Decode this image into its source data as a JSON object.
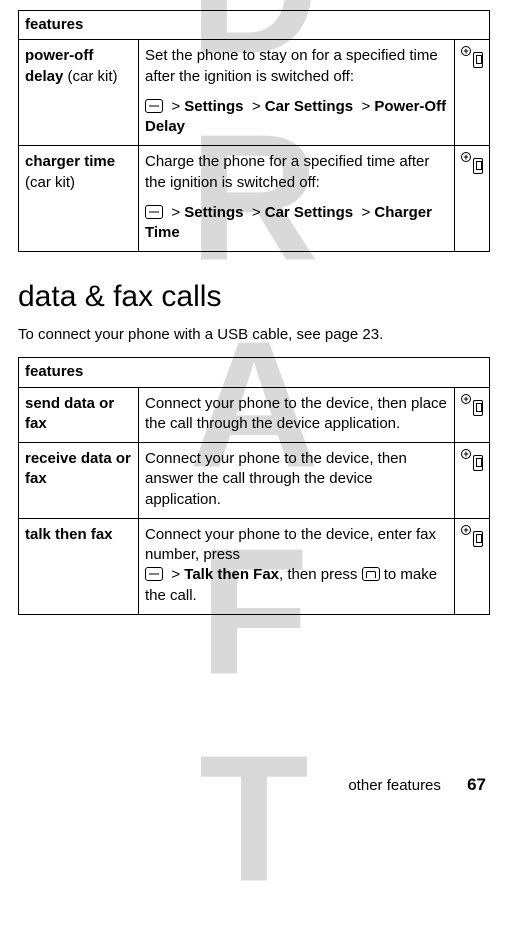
{
  "watermark": "DRAFT",
  "table1": {
    "header": "features",
    "rows": [
      {
        "name_bold": "power-off delay",
        "name_rest": " (car kit)",
        "desc": "Set the phone to stay on for a specified time after the ignition is switched off:",
        "path": [
          "Settings",
          "Car Settings",
          "Power-Off Delay"
        ],
        "icon": "accessory-required-icon"
      },
      {
        "name_bold": "charger time",
        "name_rest": " (car kit)",
        "desc": "Charge the phone for a specified time after the ignition is switched off:",
        "path": [
          "Settings",
          "Car Settings",
          "Charger Time"
        ],
        "icon": "accessory-required-icon"
      }
    ]
  },
  "section_title": "data & fax calls",
  "section_intro": "To connect your phone with a USB cable, see page 23.",
  "table2": {
    "header": "features",
    "rows": [
      {
        "name_bold": "send data or fax",
        "name_rest": "",
        "desc": "Connect your phone to the device, then place the call through the device application.",
        "icon": "accessory-required-icon"
      },
      {
        "name_bold": "receive data or fax",
        "name_rest": "",
        "desc": "Connect your phone to the device, then answer the call through the device application.",
        "icon": "accessory-required-icon"
      },
      {
        "name_bold": "talk then fax",
        "name_rest": "",
        "desc_pre": "Connect your phone to the device, enter fax number, press ",
        "desc_mid": "Talk then Fax",
        "desc_post1": ", then press ",
        "desc_post2": " to make the call.",
        "icon": "accessory-required-icon"
      }
    ]
  },
  "footer_text": "other features",
  "page_number": "67",
  "sep": ">"
}
